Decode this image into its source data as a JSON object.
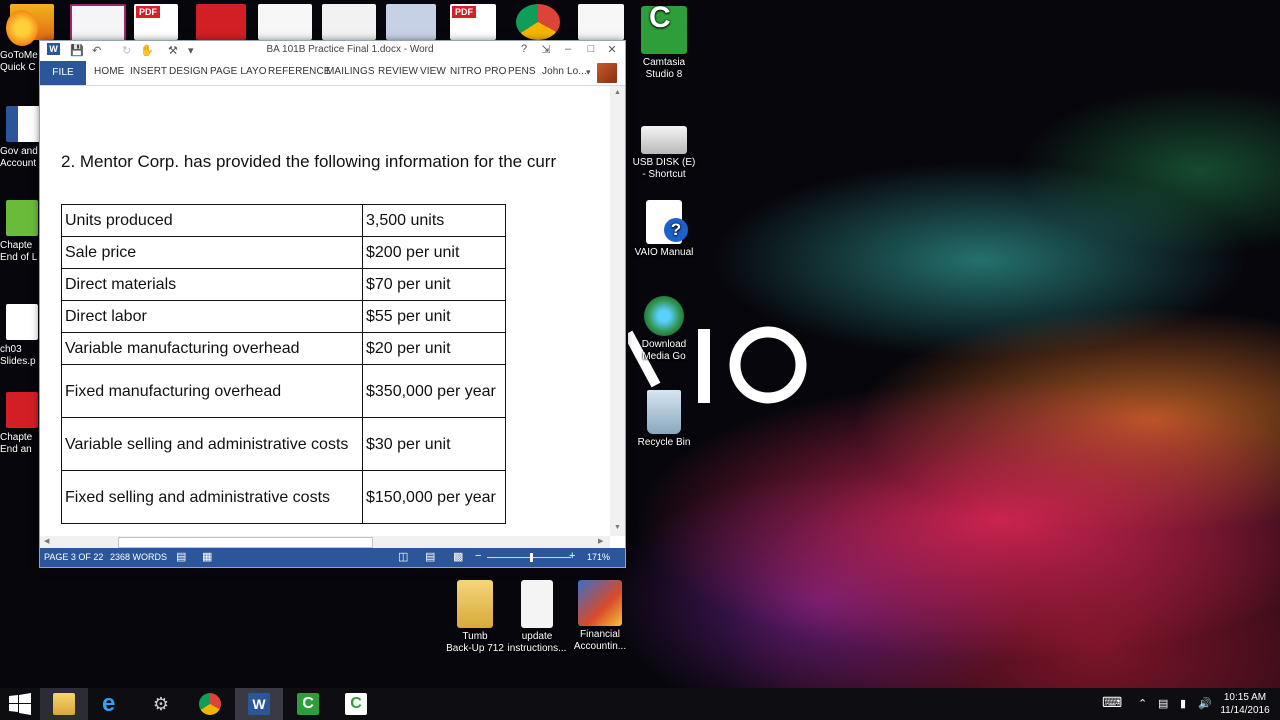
{
  "desktop": {
    "icons": [
      {
        "label_1": "Camtasia",
        "label_2": "Studio 8"
      },
      {
        "label_1": "USB DISK (E)",
        "label_2": "- Shortcut"
      },
      {
        "label_1": "VAIO Manual",
        "label_2": ""
      },
      {
        "label_1": "Download",
        "label_2": "Media Go"
      },
      {
        "label_1": "Recycle Bin",
        "label_2": ""
      },
      {
        "label_1": "Tumb",
        "label_2": "Back-Up 712"
      },
      {
        "label_1": "update",
        "label_2": "instructions..."
      },
      {
        "label_1": "Financial",
        "label_2": "Accountin..."
      }
    ],
    "cut_icons": [
      {
        "label_1": "GoToMe",
        "label_2": "Quick C"
      },
      {
        "label_1": "Gov and",
        "label_2": "Account"
      },
      {
        "label_1": "Chapte",
        "label_2": "End of L"
      },
      {
        "label_1": "ch03",
        "label_2": "Slides.p"
      },
      {
        "label_1": "Chapte",
        "label_2": "End an"
      }
    ],
    "peek_badges": [
      "PDF",
      "PDF"
    ]
  },
  "word": {
    "title": "BA 101B Practice Final 1.docx - Word",
    "help": "?",
    "tabs": {
      "file": "FILE",
      "home": "HOME",
      "insert": "INSERT",
      "design": "DESIGN",
      "page_layout": "PAGE LAYO",
      "references": "REFERENCE",
      "mailings": "MAILINGS",
      "review": "REVIEW",
      "view": "VIEW",
      "nitro": "NITRO PRO",
      "pens": "PENS"
    },
    "user": "John Lo...",
    "paragraph": "2. Mentor Corp. has provided the following information for the curr",
    "table": [
      {
        "item": "Units produced",
        "value": "3,500 units"
      },
      {
        "item": "Sale price",
        "value": "$200 per unit"
      },
      {
        "item": "Direct materials",
        "value": "$70 per unit"
      },
      {
        "item": "Direct labor",
        "value": "$55 per unit"
      },
      {
        "item": "Variable manufacturing overhead",
        "value": "$20 per unit"
      },
      {
        "item": "Fixed manufacturing overhead",
        "value": "$350,000 per year"
      },
      {
        "item": "Variable selling and administrative costs",
        "value": "$30 per unit"
      },
      {
        "item": "Fixed selling and administrative costs",
        "value": "$150,000 per year"
      }
    ],
    "status": {
      "page": "PAGE 3 OF 22",
      "words": "2368 WORDS",
      "zoom": "171%",
      "zoom_minus": "−",
      "zoom_plus": "+"
    }
  },
  "taskbar": {
    "time": "10:15 AM",
    "date": "11/14/2016",
    "tray_caret": "⌃"
  },
  "colors": {
    "word_blue": "#2b579a",
    "camtasia_green": "#2e9e3a",
    "taskbar": "#0d0d12"
  }
}
